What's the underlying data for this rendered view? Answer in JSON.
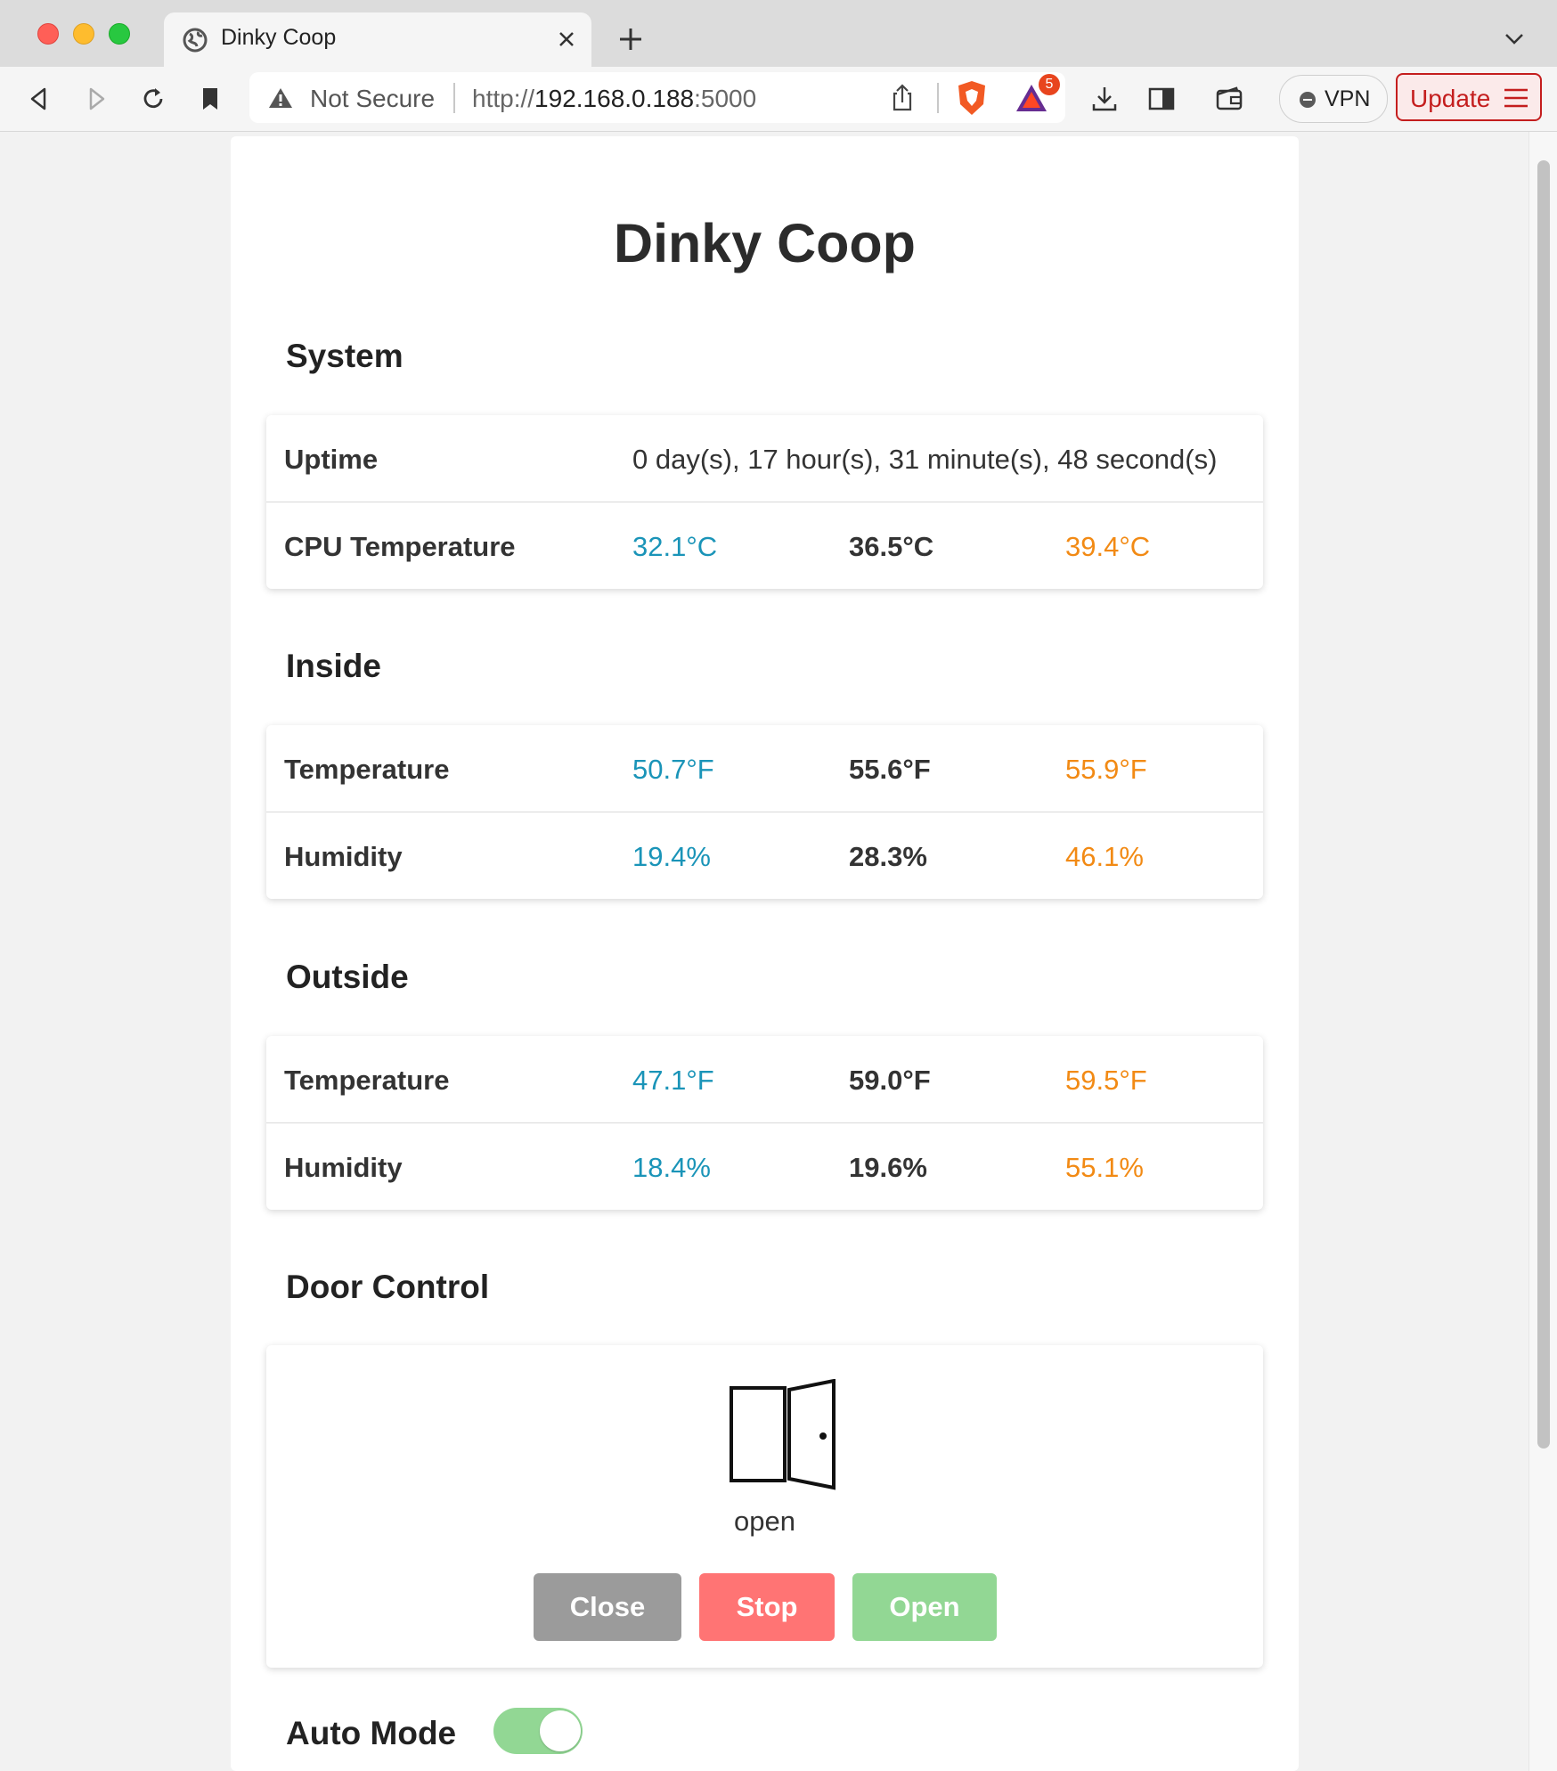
{
  "browser": {
    "tab_title": "Dinky Coop",
    "security_label": "Not Secure",
    "url_scheme": "http://",
    "url_host": "192.168.0.188",
    "url_port": ":5000",
    "shield_badge_count": "5",
    "vpn_label": "VPN",
    "update_label": "Update"
  },
  "page": {
    "title": "Dinky Coop"
  },
  "system": {
    "heading": "System",
    "uptime_label": "Uptime",
    "uptime_value": "0 day(s), 17 hour(s), 31 minute(s), 48 second(s)",
    "cpu_label": "CPU Temperature",
    "cpu_min": "32.1°C",
    "cpu_current": "36.5°C",
    "cpu_max": "39.4°C"
  },
  "inside": {
    "heading": "Inside",
    "temp_label": "Temperature",
    "temp_min": "50.7°F",
    "temp_current": "55.6°F",
    "temp_max": "55.9°F",
    "humidity_label": "Humidity",
    "humidity_min": "19.4%",
    "humidity_current": "28.3%",
    "humidity_max": "46.1%"
  },
  "outside": {
    "heading": "Outside",
    "temp_label": "Temperature",
    "temp_min": "47.1°F",
    "temp_current": "59.0°F",
    "temp_max": "59.5°F",
    "humidity_label": "Humidity",
    "humidity_min": "18.4%",
    "humidity_current": "19.6%",
    "humidity_max": "55.1%"
  },
  "door": {
    "heading": "Door Control",
    "icon": "door-open-icon",
    "state": "open",
    "close_label": "Close",
    "stop_label": "Stop",
    "open_label": "Open"
  },
  "auto_mode": {
    "label": "Auto Mode",
    "enabled": true
  },
  "colors": {
    "min_value": "#1a94b8",
    "max_value": "#f28a14",
    "close_button": "#9b9b9b",
    "stop_button": "#ff7474",
    "open_button": "#92d794",
    "toggle_on": "#92d794"
  }
}
